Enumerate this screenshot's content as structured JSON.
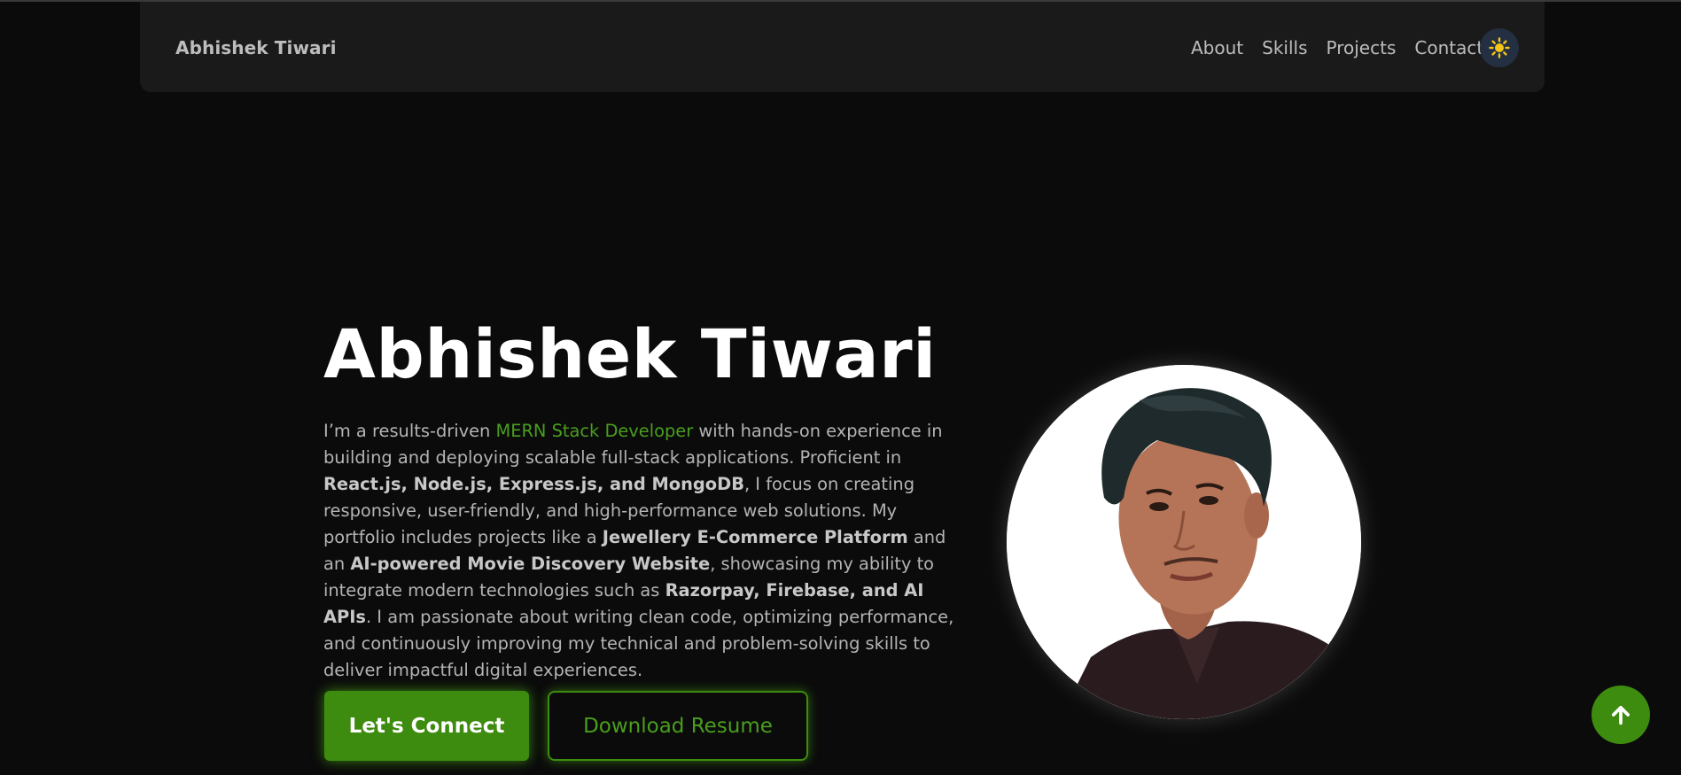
{
  "nav": {
    "brand": "Abhishek Tiwari",
    "links": [
      "About",
      "Skills",
      "Projects",
      "Contact"
    ],
    "theme_icon": "sun-icon"
  },
  "hero": {
    "title": "Abhishek Tiwari",
    "intro": {
      "t1": "I’m a results-driven ",
      "role": "MERN Stack Developer",
      "t2": " with hands-on experience in building and deploying scalable full-stack applications. Proficient in ",
      "stack": "React.js, Node.js, Express.js, and MongoDB",
      "t3": ", I focus on creating responsive, user-friendly, and high-performance web solutions. My portfolio includes projects like a ",
      "project1": "Jewellery E-Commerce Platform",
      "t4": " and an ",
      "project2": "AI-powered Movie Discovery Website",
      "t5": ", showcasing my ability to integrate modern technologies such as ",
      "tech": "Razorpay, Firebase, and AI APIs",
      "t6": ". I am passionate about writing clean code, optimizing performance, and continuously improving my technical and problem-solving skills to deliver impactful digital experiences."
    },
    "primary_button": "Let's Connect",
    "secondary_button": "Download Resume",
    "avatar_icon": "profile-photo"
  },
  "scroll_top_icon": "arrow-up-icon",
  "colors": {
    "background": "#0b0b0b",
    "navbar": "#1a1a1a",
    "accent": "#3d8b0f",
    "accent_text": "#4a9e1e",
    "sun": "#f5c518",
    "toggle_bg": "#243042"
  }
}
